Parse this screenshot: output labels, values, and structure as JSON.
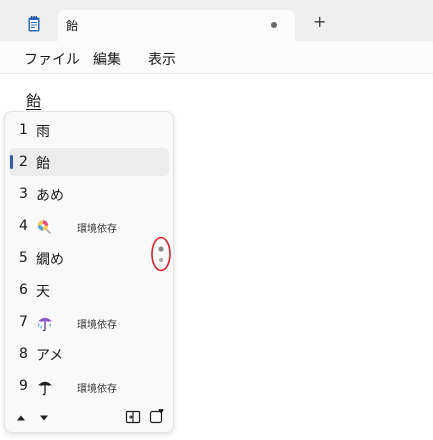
{
  "tab": {
    "title": "飴"
  },
  "menu": {
    "items": [
      "ファイル",
      "編集",
      "表示"
    ]
  },
  "editor": {
    "text": "飴"
  },
  "candidates": [
    {
      "num": "1",
      "text": "雨",
      "emoji": null,
      "note": ""
    },
    {
      "num": "2",
      "text": "飴",
      "emoji": null,
      "note": "",
      "selected": true
    },
    {
      "num": "3",
      "text": "あめ",
      "emoji": null,
      "note": ""
    },
    {
      "num": "4",
      "text": "",
      "emoji": "candy-emoji-icon",
      "note": "環境依存"
    },
    {
      "num": "5",
      "text": "繝め",
      "emoji": null,
      "note": ""
    },
    {
      "num": "6",
      "text": "天",
      "emoji": null,
      "note": ""
    },
    {
      "num": "7",
      "text": "",
      "emoji": "umbrella-rain-emoji-icon",
      "note": "環境依存"
    },
    {
      "num": "8",
      "text": "アメ",
      "emoji": null,
      "note": ""
    },
    {
      "num": "9",
      "text": "",
      "emoji": "umbrella-emoji-icon",
      "note": "環境依存"
    }
  ],
  "colors": {
    "selection_bar": "#3b5aa8",
    "highlight_circle": "#e0202a"
  }
}
